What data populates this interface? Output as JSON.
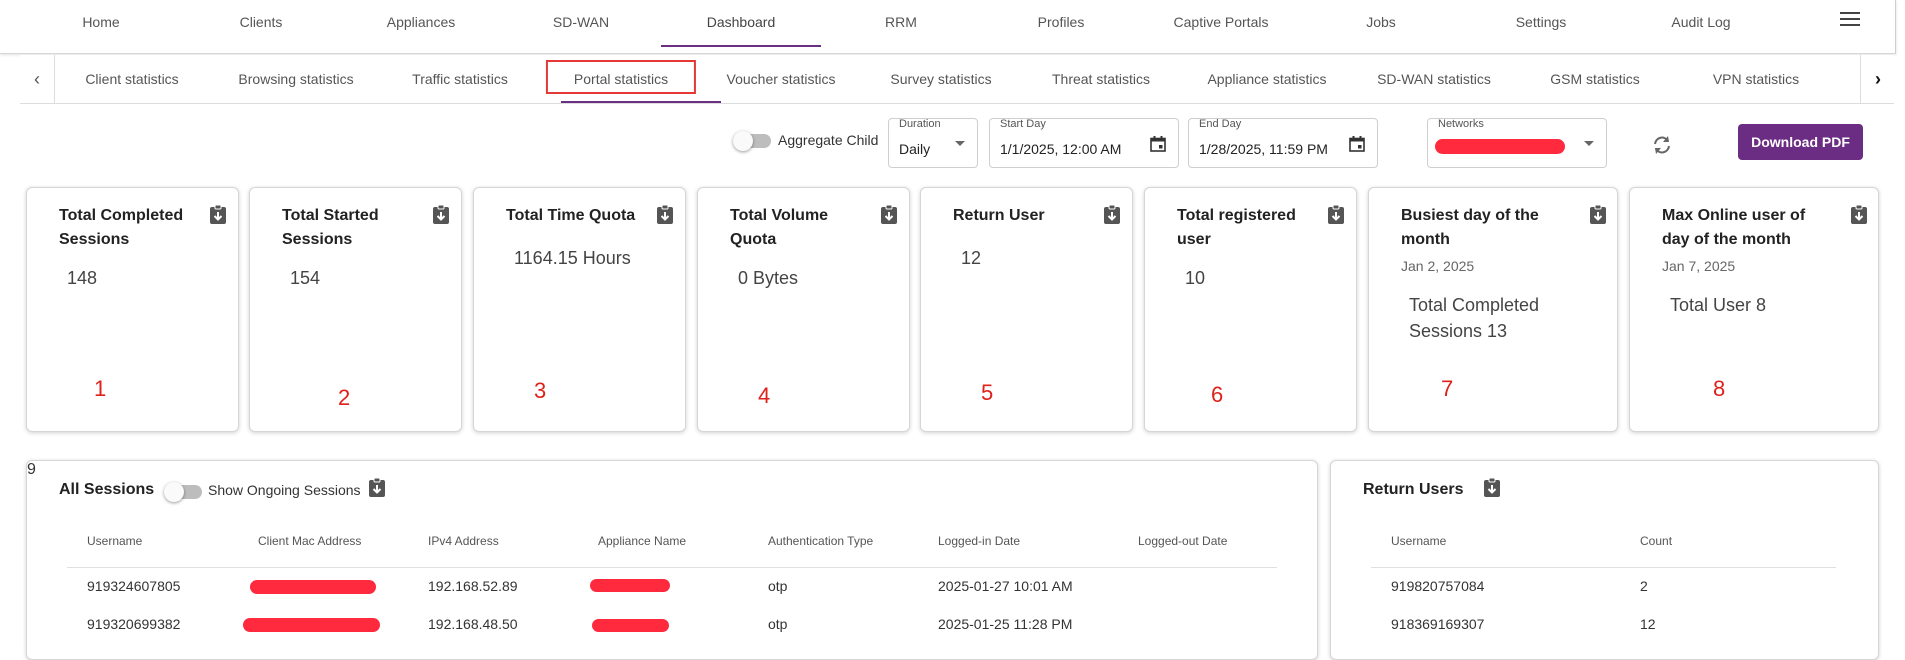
{
  "nav": {
    "items": [
      "Home",
      "Clients",
      "Appliances",
      "SD-WAN",
      "Dashboard",
      "RRM",
      "Profiles",
      "Captive Portals",
      "Jobs",
      "Settings",
      "Audit Log"
    ],
    "active": "Dashboard"
  },
  "subtabs": {
    "items": [
      "Client statistics",
      "Browsing statistics",
      "Traffic statistics",
      "Portal statistics",
      "Voucher statistics",
      "Survey statistics",
      "Threat statistics",
      "Appliance statistics",
      "SD-WAN statistics",
      "GSM statistics",
      "VPN statistics"
    ],
    "active": "Portal statistics"
  },
  "filters": {
    "aggregate_label": "Aggregate Child",
    "duration_label": "Duration",
    "duration_value": "Daily",
    "start_label": "Start Day",
    "start_value": "1/1/2025, 12:00 AM",
    "end_label": "End Day",
    "end_value": "1/28/2025, 11:59 PM",
    "networks_label": "Networks",
    "download_label": "Download PDF"
  },
  "cards": [
    {
      "title": "Total Completed Sessions",
      "value": "148",
      "annotation": "1"
    },
    {
      "title": "Total Started Sessions",
      "value": "154",
      "annotation": "2"
    },
    {
      "title": "Total Time Quota",
      "value": "1164.15 Hours",
      "annotation": "3"
    },
    {
      "title": "Total Volume Quota",
      "value": "0 Bytes",
      "annotation": "4"
    },
    {
      "title": "Return User",
      "value": "12",
      "annotation": "5"
    },
    {
      "title": "Total registered user",
      "value": "10",
      "annotation": "6"
    },
    {
      "title": "Busiest day of the month",
      "date": "Jan 2, 2025",
      "value": "Total Completed Sessions 13",
      "annotation": "7"
    },
    {
      "title": "Max Online user of day of the month",
      "date": "Jan 7, 2025",
      "value": "Total User 8",
      "annotation": "8"
    }
  ],
  "sessions": {
    "title": "All Sessions",
    "toggle_label": "Show Ongoing Sessions",
    "annotation": "9",
    "columns": [
      "Username",
      "Client Mac Address",
      "IPv4 Address",
      "Appliance Name",
      "Authentication Type",
      "Logged-in Date",
      "Logged-out Date"
    ],
    "rows": [
      {
        "username": "919324607805",
        "ipv4": "192.168.52.89",
        "auth": "otp",
        "logged_in": "2025-01-27 10:01 AM",
        "logged_out": ""
      },
      {
        "username": "919320699382",
        "ipv4": "192.168.48.50",
        "auth": "otp",
        "logged_in": "2025-01-25 11:28 PM",
        "logged_out": ""
      }
    ]
  },
  "return_users": {
    "title": "Return Users",
    "columns": [
      "Username",
      "Count"
    ],
    "rows": [
      {
        "username": "919820757084",
        "count": "2"
      },
      {
        "username": "918369169307",
        "count": "12"
      }
    ]
  },
  "colors": {
    "accent": "#6b2c84",
    "redaction": "#ff2a3d",
    "annotation": "#e0201a",
    "highlight_box": "#e53935"
  }
}
